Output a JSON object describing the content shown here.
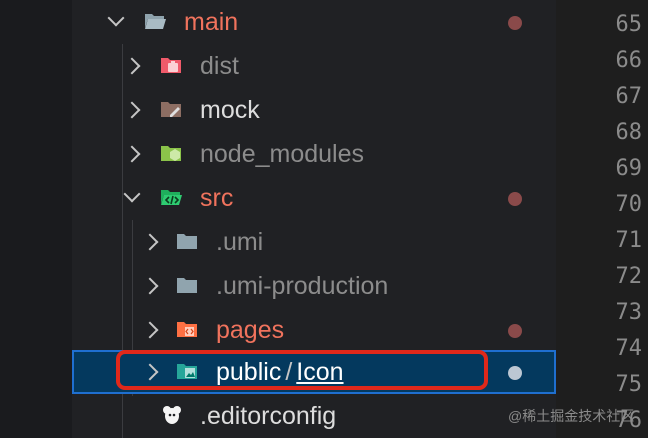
{
  "tree": [
    {
      "label": "main",
      "expanded": true,
      "color": "#f0735d",
      "icon": "folder-open-icon",
      "modified": true
    },
    {
      "label": "dist",
      "expanded": false,
      "color": "#8c8c8c",
      "icon": "dist-folder-icon",
      "modified": false
    },
    {
      "label": "mock",
      "expanded": false,
      "color": "#dddddd",
      "icon": "mock-folder-icon",
      "modified": false
    },
    {
      "label": "node_modules",
      "expanded": false,
      "color": "#8c8c8c",
      "icon": "node-modules-folder-icon",
      "modified": false
    },
    {
      "label": "src",
      "expanded": true,
      "color": "#f0735d",
      "icon": "src-folder-icon",
      "modified": true
    },
    {
      "label": ".umi",
      "expanded": false,
      "color": "#8c8c8c",
      "icon": "folder-icon",
      "modified": false
    },
    {
      "label": ".umi-production",
      "expanded": false,
      "color": "#8c8c8c",
      "icon": "folder-icon",
      "modified": false
    },
    {
      "label": "pages",
      "expanded": false,
      "color": "#f0735d",
      "icon": "pages-folder-icon",
      "modified": true
    },
    {
      "label_prefix": "public",
      "separator": "/",
      "label_suffix": "Icon",
      "expanded": false,
      "color": "#ffffff",
      "icon": "images-folder-icon",
      "modified": true,
      "selected": true
    },
    {
      "label": ".editorconfig",
      "color": "#dddddd",
      "icon": "editorconfig-file-icon",
      "modified": false
    }
  ],
  "line_numbers": [
    "65",
    "66",
    "67",
    "68",
    "69",
    "70",
    "71",
    "72",
    "73",
    "74",
    "75",
    "76"
  ],
  "watermark": "@稀土掘金技术社区",
  "colors": {
    "modified_dot": "#8a4a4a",
    "selection": "#04395e",
    "annotation": "#e0281a"
  }
}
